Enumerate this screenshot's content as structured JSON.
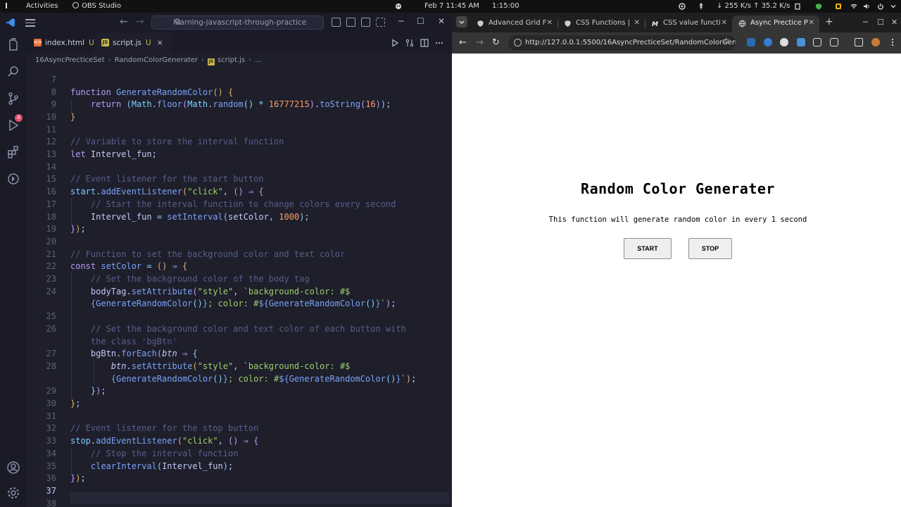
{
  "topbar": {
    "activities": "Activities",
    "app": "OBS Studio",
    "datetime": "Feb 7  11:45 AM",
    "timer": "1:15:00",
    "network": "↓ 255 K/s ↑ 35.2 K/s"
  },
  "vscode": {
    "search": "learning-javascript-through-practice",
    "tabs": [
      {
        "name": "index.html",
        "status": "U"
      },
      {
        "name": "script.js",
        "status": "U",
        "close": "×"
      }
    ],
    "breadcrumb": [
      "16AsyncPrecticeSet",
      "RandomColorGenerater",
      "script.js",
      "..."
    ],
    "git_badge": "4",
    "line_numbers": [
      "7",
      "8",
      "9",
      "10",
      "11",
      "12",
      "13",
      "14",
      "15",
      "16",
      "17",
      "18",
      "19",
      "20",
      "21",
      "22",
      "23",
      "24",
      "",
      "25",
      "26",
      "",
      "27",
      "28",
      "",
      "29",
      "30",
      "31",
      "32",
      "33",
      "34",
      "35",
      "36",
      "37",
      "38"
    ]
  },
  "chrome": {
    "tabs": [
      {
        "title": "Advanced Grid F"
      },
      {
        "title": "CSS Functions | "
      },
      {
        "title": "CSS value functi"
      },
      {
        "title": "Async Prectice P"
      }
    ],
    "url": "http://127.0.0.1:5500/16AsyncPrecticeSet/RandomColorGener..."
  },
  "page": {
    "title": "Random Color Generater",
    "description": "This function will generate random color in every 1 second",
    "start_label": "START",
    "stop_label": "STOP"
  },
  "colors": {
    "editor_bg": "#1e1f2b",
    "keyword": "#bb9af7",
    "function": "#7aa2f7",
    "string": "#9ece6a",
    "number": "#ff9e64",
    "comment": "#565f89"
  }
}
